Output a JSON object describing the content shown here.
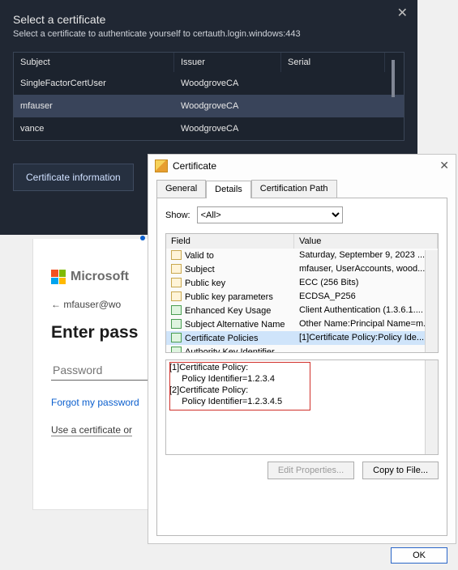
{
  "dark": {
    "title": "Select a certificate",
    "subtitle": "Select a certificate to authenticate yourself to certauth.login.windows:443",
    "close_glyph": "✕",
    "columns": {
      "subject": "Subject",
      "issuer": "Issuer",
      "serial": "Serial"
    },
    "rows": [
      {
        "subject": "SingleFactorCertUser",
        "issuer": "WoodgroveCA",
        "serial": ""
      },
      {
        "subject": "mfauser",
        "issuer": "WoodgroveCA",
        "serial": ""
      },
      {
        "subject": "vance",
        "issuer": "WoodgroveCA",
        "serial": ""
      }
    ],
    "selected_index": 1,
    "cert_info_btn": "Certificate information"
  },
  "signin": {
    "brand": "Microsoft",
    "back_glyph": "←",
    "user": "mfauser@wo",
    "heading": "Enter pass",
    "password_placeholder": "Password",
    "forgot_link": "Forgot my password",
    "alt_link": "Use a certificate or"
  },
  "cert": {
    "title": "Certificate",
    "close_glyph": "✕",
    "tabs": {
      "general": "General",
      "details": "Details",
      "path": "Certification Path"
    },
    "active_tab": "details",
    "show_label": "Show:",
    "show_value": "<All>",
    "columns": {
      "field": "Field",
      "value": "Value"
    },
    "rows": [
      {
        "field": "Valid to",
        "value": "Saturday, September 9, 2023 ...",
        "ico": "doc"
      },
      {
        "field": "Subject",
        "value": "mfauser, UserAccounts, wood...",
        "ico": "doc"
      },
      {
        "field": "Public key",
        "value": "ECC (256 Bits)",
        "ico": "doc"
      },
      {
        "field": "Public key parameters",
        "value": "ECDSA_P256",
        "ico": "doc"
      },
      {
        "field": "Enhanced Key Usage",
        "value": "Client Authentication (1.3.6.1....",
        "ico": "green"
      },
      {
        "field": "Subject Alternative Name",
        "value": "Other Name:Principal Name=m...",
        "ico": "green"
      },
      {
        "field": "Certificate Policies",
        "value": "[1]Certificate Policy:Policy Ide...",
        "ico": "green"
      },
      {
        "field": "Authority Key Identifier",
        "value": "",
        "ico": "green"
      }
    ],
    "selected_row": 6,
    "policy_lines": [
      "[1]Certificate Policy:",
      "     Policy Identifier=1.2.3.4",
      "[2]Certificate Policy:",
      "     Policy Identifier=1.2.3.4.5"
    ],
    "edit_btn": "Edit Properties...",
    "copy_btn": "Copy to File...",
    "ok_btn": "OK"
  }
}
